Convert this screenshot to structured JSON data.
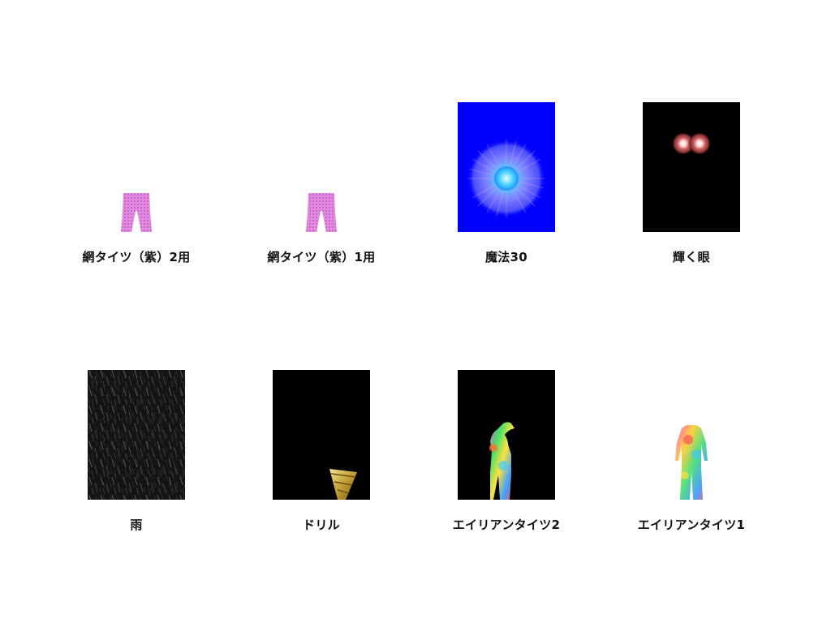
{
  "items": [
    {
      "label": "網タイツ（紫）2用",
      "thumbnail": "fishnet-tights-purple-icon"
    },
    {
      "label": "網タイツ（紫）1用",
      "thumbnail": "fishnet-tights-purple-icon"
    },
    {
      "label": "魔法30",
      "thumbnail": "magic-burst-icon"
    },
    {
      "label": "輝く眼",
      "thumbnail": "glowing-eyes-icon"
    },
    {
      "label": "雨",
      "thumbnail": "rain-icon"
    },
    {
      "label": "ドリル",
      "thumbnail": "drill-icon"
    },
    {
      "label": "エイリアンタイツ2",
      "thumbnail": "alien-tights-figure-icon"
    },
    {
      "label": "エイリアンタイツ1",
      "thumbnail": "alien-tights-bodysuit-icon"
    }
  ],
  "colors": {
    "background": "#ffffff",
    "label_text": "#111111",
    "tights_purple": "#d070d0",
    "magic_blue": "#0000ff",
    "dark_tile": "#000000"
  }
}
